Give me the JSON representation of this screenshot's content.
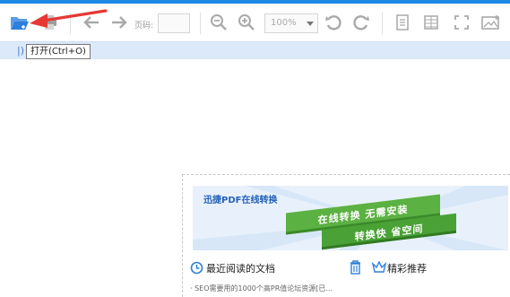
{
  "toolbar": {
    "page_label": "页码:",
    "page_value": "",
    "zoom_value": "100%"
  },
  "tooltip": {
    "text": "打开(Ctrl+O)"
  },
  "tabstrip": {
    "mark": "|)"
  },
  "start_panel": {
    "banner_title": "迅捷PDF在线转换",
    "ribbon_line1": "在线转换 无需安装",
    "ribbon_line2": "转换快 省空间",
    "recent_docs_title": "最近阅读的文档",
    "featured_label": "精彩推荐",
    "recent_item_1": "· SEO需要用的1000个高PR值论坛资源[已..."
  },
  "colors": {
    "accent": "#1e88e5",
    "tabstrip": "#dbe9fb",
    "ribbon_green": "#5bb142",
    "annotation_arrow": "#e53935",
    "title_blue": "#2461b8"
  },
  "icons": [
    "open-folder-icon",
    "print-icon",
    "back-arrow-icon",
    "forward-arrow-icon",
    "zoom-out-icon",
    "zoom-in-icon",
    "rotate-left-icon",
    "rotate-right-icon",
    "single-page-icon",
    "two-page-icon",
    "fullscreen-icon",
    "screenshot-icon",
    "clock-icon",
    "trash-icon",
    "crown-icon"
  ]
}
